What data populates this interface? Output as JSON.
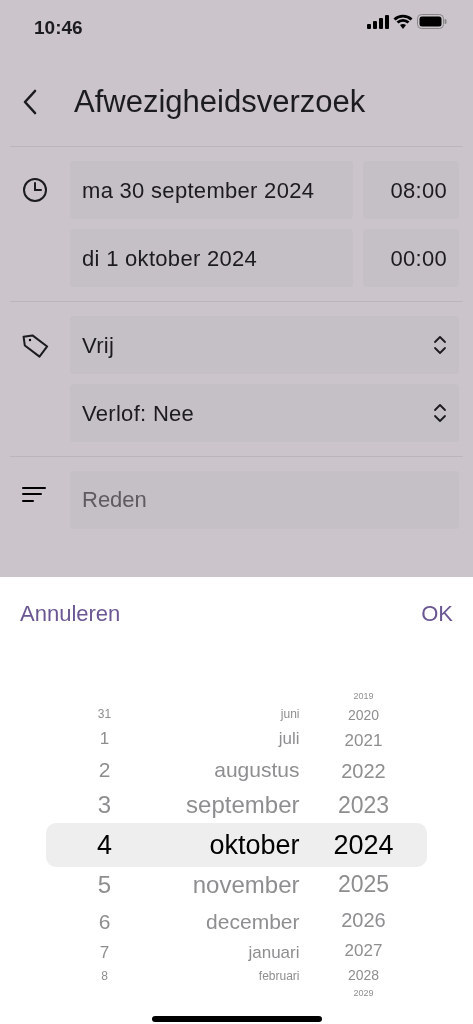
{
  "status_bar": {
    "time": "10:46"
  },
  "header": {
    "title": "Afwezigheidsverzoek"
  },
  "sections": [
    {
      "kind": "datetime",
      "rows": [
        {
          "date": "ma 30 september 2024",
          "time": "08:00"
        },
        {
          "date": "di 1 oktober 2024",
          "time": "00:00"
        }
      ]
    },
    {
      "kind": "select",
      "options": [
        "Vrij",
        "Verlof: Nee"
      ]
    },
    {
      "kind": "text",
      "placeholder": "Reden"
    }
  ],
  "sheet": {
    "cancel": "Annuleren",
    "confirm": "OK",
    "columns": [
      {
        "kind": "day",
        "items": [
          {
            "label": "31",
            "selected": false
          },
          {
            "label": "1",
            "selected": false
          },
          {
            "label": "2",
            "selected": false
          },
          {
            "label": "3",
            "selected": false
          },
          {
            "label": "4",
            "selected": true
          },
          {
            "label": "5",
            "selected": false
          },
          {
            "label": "6",
            "selected": false
          },
          {
            "label": "7",
            "selected": false
          },
          {
            "label": "8",
            "selected": false
          }
        ]
      },
      {
        "kind": "month",
        "items": [
          {
            "label": "juni",
            "selected": false
          },
          {
            "label": "juli",
            "selected": false
          },
          {
            "label": "augustus",
            "selected": false
          },
          {
            "label": "september",
            "selected": false
          },
          {
            "label": "oktober",
            "selected": true
          },
          {
            "label": "november",
            "selected": false
          },
          {
            "label": "december",
            "selected": false
          },
          {
            "label": "januari",
            "selected": false
          },
          {
            "label": "februari",
            "selected": false
          }
        ]
      },
      {
        "kind": "year",
        "items": [
          {
            "label": "2019",
            "selected": false
          },
          {
            "label": "2020",
            "selected": false
          },
          {
            "label": "2021",
            "selected": false
          },
          {
            "label": "2022",
            "selected": false
          },
          {
            "label": "2023",
            "selected": false
          },
          {
            "label": "2024",
            "selected": true
          },
          {
            "label": "2025",
            "selected": false
          },
          {
            "label": "2026",
            "selected": false
          },
          {
            "label": "2027",
            "selected": false
          },
          {
            "label": "2028",
            "selected": false
          },
          {
            "label": "2029",
            "selected": false
          }
        ]
      }
    ]
  }
}
